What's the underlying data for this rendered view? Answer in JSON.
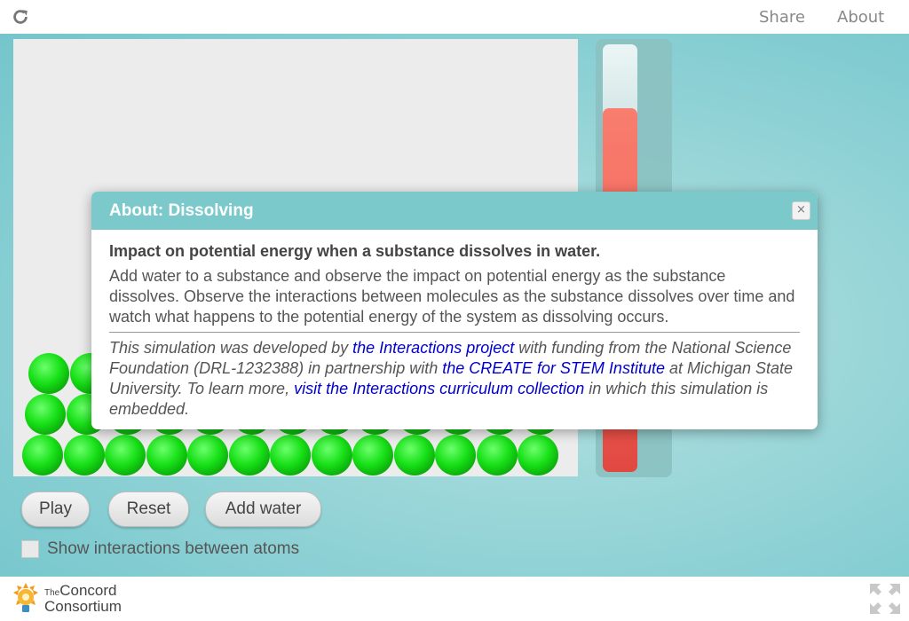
{
  "topbar": {
    "share_label": "Share",
    "about_label": "About"
  },
  "controls": {
    "play_label": "Play",
    "reset_label": "Reset",
    "add_water_label": "Add water",
    "show_interactions_label": "Show interactions between atoms",
    "show_interactions_checked": false
  },
  "energy_bar": {
    "level_fraction": 0.85,
    "fill_color": "#f45c50"
  },
  "atom_color": "#17e017",
  "footer": {
    "logo_prefix": "The",
    "logo_line1": "Concord",
    "logo_line2": "Consortium"
  },
  "dialog": {
    "title": "About: Dissolving",
    "heading": "Impact on potential energy when a substance dissolves in water.",
    "paragraph": "Add water to a substance and observe the impact on potential energy as the substance dissolves. Observe the interactions between molecules as the substance dissolves over time and watch what happens to the potential energy of the system as dissolving occurs.",
    "credit_part1": "This simulation was developed by ",
    "credit_link1": "the Interactions project",
    "credit_part2": " with funding from the National Science Foundation (DRL-1232388) in partnership with ",
    "credit_link2": "the CREATE for STEM Institute",
    "credit_part3": " at Michigan State University. To learn more, ",
    "credit_link3": "visit the Interactions curriculum collection",
    "credit_part4": " in which this simulation is embedded.",
    "close_glyph": "×"
  }
}
